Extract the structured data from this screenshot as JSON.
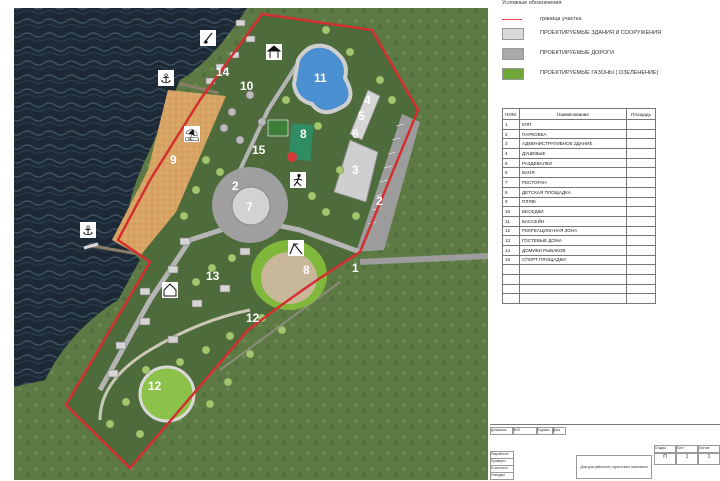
{
  "legend": {
    "header_label": "Условные обозначения",
    "boundary_label": "граница участка",
    "boundary_color": "#e0474c",
    "buildings_label": "ПРОЕКТИРУЕМЫЕ ЗДАНИЯ И СООРУЖЕНИЯ",
    "buildings_color": "#d9d9d9",
    "roads_label": "ПРОЕКТИРУЕМЫЕ ДОРОГИ",
    "roads_color": "#a9a9a9",
    "lawns_label": "ПРОЕКТИРУЕМЫЕ ГАЗОНЫ ( ОЗЕЛЕНЕНИЕ)",
    "lawns_color": "#6fa63a"
  },
  "table": {
    "headers": [
      "НОМ.",
      "Наименование",
      "Площадь"
    ],
    "rows": [
      {
        "num": "1",
        "name": "КПП"
      },
      {
        "num": "2",
        "name": "ПАРКОВКА"
      },
      {
        "num": "3",
        "name": "АДМИНИСТРАТИВНОЕ ЗДАНИЕ"
      },
      {
        "num": "4",
        "name": "ДУШЕВЫЕ"
      },
      {
        "num": "5",
        "name": "РАЗДЕВАЛКИ"
      },
      {
        "num": "6",
        "name": "БАНЯ"
      },
      {
        "num": "7",
        "name": "РЕСТОРАН"
      },
      {
        "num": "8",
        "name": "ДЕТСКАЯ ПЛОЩАДКА"
      },
      {
        "num": "9",
        "name": "ПЛЯЖ"
      },
      {
        "num": "10",
        "name": "БЕСЕДКИ"
      },
      {
        "num": "11",
        "name": "БАССЕЙН"
      },
      {
        "num": "12",
        "name": "РЕКРЕАЦИОННАЯ ЗОНА"
      },
      {
        "num": "13",
        "name": "ГОСТЕВЫЕ ДОМА"
      },
      {
        "num": "14",
        "name": "ДОМИКИ РЫБАКОВ"
      },
      {
        "num": "15",
        "name": "СПОРТ ПЛОЩАДКИ"
      }
    ],
    "empty_rows": 4
  },
  "stamp": {
    "col_labels": [
      "Должность",
      "ФИО",
      "Подпись",
      "Дата"
    ],
    "row_labels": [
      "Разработал",
      "Проверил",
      "Н.контроль",
      "Утвердил"
    ],
    "title": "Дом для районного туристского комплекса",
    "stage_label": "Стадия",
    "sheet_label": "Лист",
    "sheets_label": "Листов",
    "stage_value": "П",
    "sheet_value": "1",
    "sheets_value": "1"
  },
  "map_labels": {
    "l1": "1",
    "l2a": "2",
    "l2b": "2",
    "l3": "3",
    "l4": "4",
    "l5": "5",
    "l6": "6",
    "l7": "7",
    "l8": "8",
    "l8b": "8",
    "l9": "9",
    "l10": "10",
    "l11": "11",
    "l12a": "12",
    "l12b": "12",
    "l13": "13",
    "l14": "14",
    "l15": "15"
  },
  "colors": {
    "water": "#1d2a36",
    "grass_site": "#4e6b3b",
    "meadow": "#5d7a45",
    "beach": "#d8a464",
    "road": "#b5b5b5",
    "pool": "#4a8fd0",
    "boundary": "#d32f2f"
  }
}
